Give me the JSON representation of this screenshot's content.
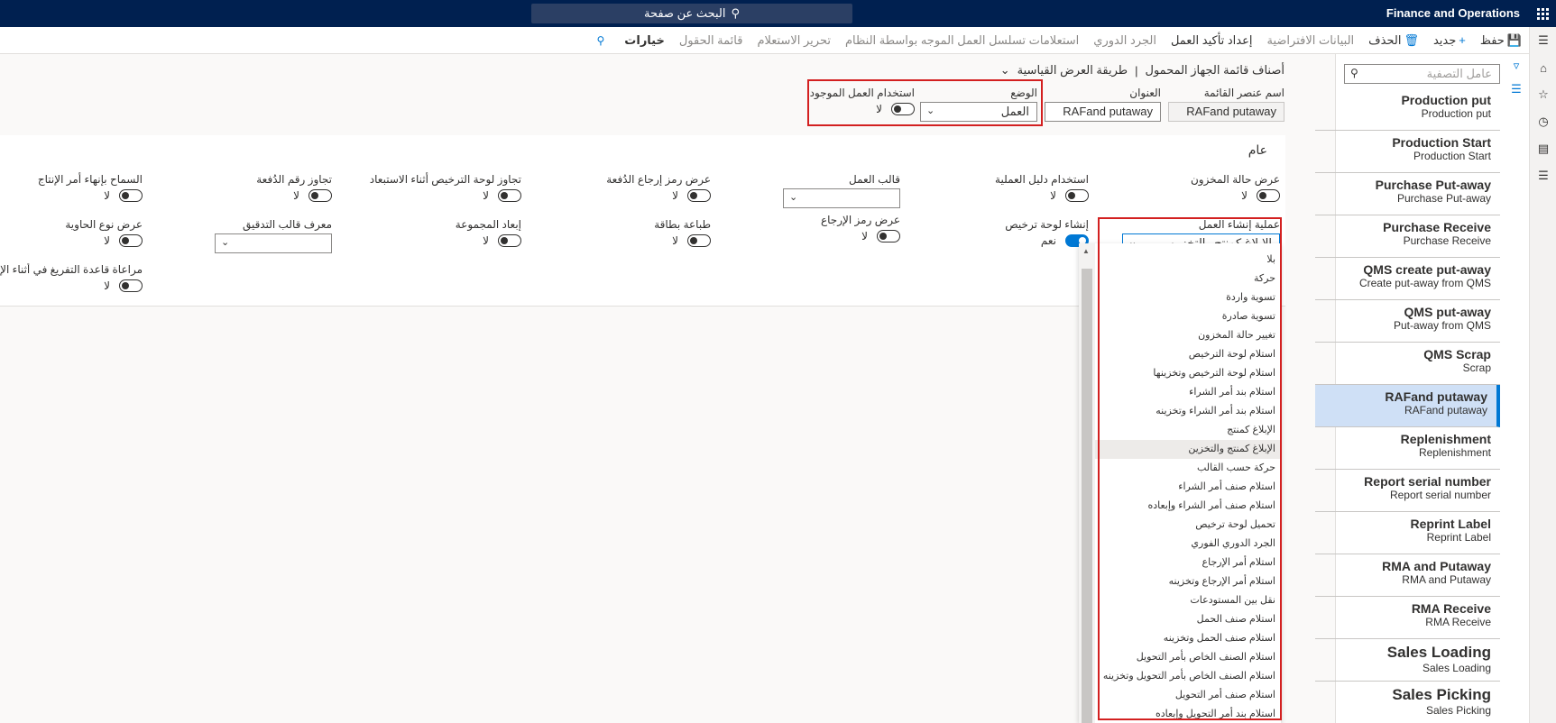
{
  "topbar": {
    "app_title": "Finance and Operations",
    "search_label": "البحث عن صفحة"
  },
  "actions": [
    {
      "label": "حفظ",
      "icon": "save-icon",
      "disabled": false,
      "bold": false
    },
    {
      "label": "جديد",
      "icon": "plus-icon",
      "disabled": false,
      "bold": false
    },
    {
      "label": "الحذف",
      "icon": "trash-icon",
      "disabled": false,
      "bold": false
    },
    {
      "label": "البيانات الافتراضية",
      "icon": "",
      "disabled": true,
      "bold": false
    },
    {
      "label": "إعداد تأكيد العمل",
      "icon": "",
      "disabled": false,
      "bold": false
    },
    {
      "label": "الجرد الدوري",
      "icon": "",
      "disabled": true,
      "bold": false
    },
    {
      "label": "استعلامات تسلسل العمل الموجه بواسطة النظام",
      "icon": "",
      "disabled": true,
      "bold": false
    },
    {
      "label": "تحرير الاستعلام",
      "icon": "",
      "disabled": true,
      "bold": false
    },
    {
      "label": "قائمة الحقول",
      "icon": "",
      "disabled": true,
      "bold": false
    },
    {
      "label": "خيارات",
      "icon": "",
      "disabled": false,
      "bold": true
    }
  ],
  "filter": {
    "placeholder": "عامل التصفية"
  },
  "records": [
    {
      "title": "Production put",
      "sub": "Production put",
      "selected": false
    },
    {
      "title": "Production Start",
      "sub": "Production Start",
      "selected": false
    },
    {
      "title": "Purchase Put-away",
      "sub": "Purchase Put-away",
      "selected": false
    },
    {
      "title": "Purchase Receive",
      "sub": "Purchase Receive",
      "selected": false
    },
    {
      "title": "QMS create put-away",
      "sub": "Create put-away from QMS",
      "selected": false
    },
    {
      "title": "QMS put-away",
      "sub": "Put-away from QMS",
      "selected": false
    },
    {
      "title": "QMS Scrap",
      "sub": "Scrap",
      "selected": false
    },
    {
      "title": "RAFand putaway",
      "sub": "RAFand putaway",
      "selected": true
    },
    {
      "title": "Replenishment",
      "sub": "Replenishment",
      "selected": false
    },
    {
      "title": "Report serial number",
      "sub": "Report serial number",
      "selected": false
    },
    {
      "title": "Reprint Label",
      "sub": "Reprint Label",
      "selected": false
    },
    {
      "title": "RMA and Putaway",
      "sub": "RMA and Putaway",
      "selected": false
    },
    {
      "title": "RMA Receive",
      "sub": "RMA Receive",
      "selected": false
    },
    {
      "title": "Sales Loading",
      "sub": "Sales Loading",
      "selected": false
    },
    {
      "title": "Sales Picking",
      "sub": "Sales Picking",
      "selected": false
    }
  ],
  "breadcrumb": {
    "page": "أصناف قائمة الجهاز المحمول",
    "separator": "|",
    "view": "طريقة العرض القياسية"
  },
  "header": {
    "item_name_label": "اسم عنصر القائمة",
    "item_name_value": "RAFand putaway",
    "title_label": "العنوان",
    "title_value": "RAFand putaway",
    "mode_label": "الوضع",
    "mode_value": "العمل",
    "use_existing_label": "استخدام العمل الموجود",
    "use_existing_value": "لا"
  },
  "general": {
    "section_title": "عام",
    "display_inventory_status": {
      "label": "عرض حالة المخزون",
      "value": "لا"
    },
    "use_process_guide": {
      "label": "استخدام دليل العملية",
      "value": "لا"
    },
    "work_template": {
      "label": "قالب العمل",
      "value": ""
    },
    "display_batch_disposition": {
      "label": "عرض رمز إرجاع الدُفعة",
      "value": "لا"
    },
    "override_lp_during_putaway": {
      "label": "تجاوز لوحة الترخيص أثناء الاستبعاد",
      "value": "لا"
    },
    "override_batch_number": {
      "label": "تجاوز رقم الدُفعة",
      "value": "لا"
    },
    "allow_end_production": {
      "label": "السماح بإنهاء أمر الإنتاج",
      "value": "لا"
    },
    "work_creation_process": {
      "label": "عملية إنشاء العمل",
      "value": "الإبلاغ كمنتج والتخزين"
    },
    "generate_license_plate": {
      "label": "إنشاء لوحة ترخيص",
      "value": "نعم"
    },
    "display_return_code": {
      "label": "عرض رمز الإرجاع",
      "value": "لا"
    },
    "print_label": {
      "label": "طباعة بطاقة",
      "value": "لا"
    },
    "group_putaway": {
      "label": "إبعاد المجموعة",
      "value": "لا"
    },
    "audit_template_id": {
      "label": "معرف قالب التدقيق",
      "value": ""
    },
    "display_container_type": {
      "label": "عرض نوع الحاوية",
      "value": "لا"
    },
    "observe_unload_rule": {
      "label": "مراعاة قاعدة التفريغ في أثناء الإنتا..",
      "value": "لا"
    }
  },
  "dropdown": {
    "options": [
      "بلا",
      "حركة",
      "تسوية واردة",
      "تسوية صادرة",
      "تغيير حالة المخزون",
      "استلام لوحة الترخيص",
      "استلام لوحة الترخيص وتخزينها",
      "استلام بند أمر الشراء",
      "استلام بند أمر الشراء وتخزينه",
      "الإبلاغ كمنتج",
      "الإبلاغ كمنتج والتخزين",
      "حركة حسب القالب",
      "استلام صنف أمر الشراء",
      "استلام صنف أمر الشراء وإبعاده",
      "تحميل لوحة ترخيص",
      "الجرد الدوري الفوري",
      "استلام أمر الإرجاع",
      "استلام أمر الإرجاع وتخزينه",
      "نقل بين المستودعات",
      "استلام صنف الحمل",
      "استلام صنف الحمل وتخزينه",
      "استلام الصنف الخاص بأمر التحويل",
      "استلام الصنف الخاص بأمر التحويل وتخزينه",
      "استلام صنف أمر التحويل",
      "استلام بند أمر التحويل وإبعاده"
    ],
    "highlighted": "الإبلاغ كمنتج والتخزين"
  },
  "colors": {
    "nav": "#002050",
    "accent": "#0078d4",
    "highlight_box": "#d32020"
  }
}
